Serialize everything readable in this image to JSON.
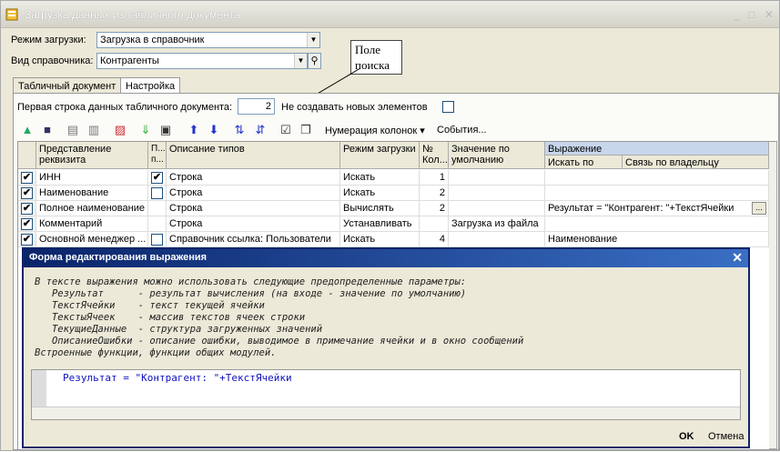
{
  "window": {
    "title": "Загрузка данных из табличного документа"
  },
  "form": {
    "mode_label": "Режим загрузки:",
    "mode_value": "Загрузка в справочник",
    "kind_label": "Вид справочника:",
    "kind_value": "Контрагенты",
    "first_row_label": "Первая строка данных табличного документа:",
    "first_row_value": "2",
    "no_new_label": "Не создавать новых элементов"
  },
  "callout": "Поле поиска",
  "tabs": [
    "Табличный документ",
    "Настройка"
  ],
  "toolbar": {
    "numbering_label": "Нумерация колонок",
    "events_label": "События..."
  },
  "grid": {
    "headers": {
      "name": "Представление реквизита",
      "search": "П... п...",
      "types": "Описание типов",
      "mode": "Режим загрузки",
      "col": "№ Кол...",
      "default": "Значение по умолчанию",
      "expr": "Выражение",
      "search_by": "Искать по",
      "owner": "Связь по владельцу"
    },
    "rows": [
      {
        "name": "ИНН",
        "search": true,
        "types": "Строка",
        "mode": "Искать",
        "col": "1",
        "default": "",
        "expr": ""
      },
      {
        "name": "Наименование",
        "search": false,
        "types": "Строка",
        "mode": "Искать",
        "col": "2",
        "default": "",
        "expr": ""
      },
      {
        "name": "Полное наименование",
        "search": null,
        "types": "Строка",
        "mode": "Вычислять",
        "col": "2",
        "default": "",
        "expr": "Результат = \"Контрагент: \"+ТекстЯчейки"
      },
      {
        "name": "Комментарий",
        "search": null,
        "types": "Строка",
        "mode": "Устанавливать",
        "col": "",
        "default": "Загрузка из файла",
        "expr": ""
      },
      {
        "name": "Основной менеджер ...",
        "search": false,
        "types": "Справочник ссылка: Пользователи",
        "mode": "Искать",
        "col": "4",
        "default": "",
        "expr": "Наименование"
      }
    ]
  },
  "dialog": {
    "title": "Форма редактирования выражения",
    "hint": "В тексте выражения можно использовать следующие предопределенные параметры:\n   Результат      - результат вычисления (на входе - значение по умолчанию)\n   ТекстЯчейки    - текст текущей ячейки\n   ТекстыЯчеек    - массив текстов ячеек строки\n   ТекущиеДанные  - структура загруженных значений\n   ОписаниеОшибки - описание ошибки, выводимое в примечание ячейки и в окно сообщений\nВстроенные функции, функции общих модулей.",
    "code": "Результат = \"Контрагент: \"+ТекстЯчейки",
    "ok": "OK",
    "cancel": "Отмена"
  }
}
